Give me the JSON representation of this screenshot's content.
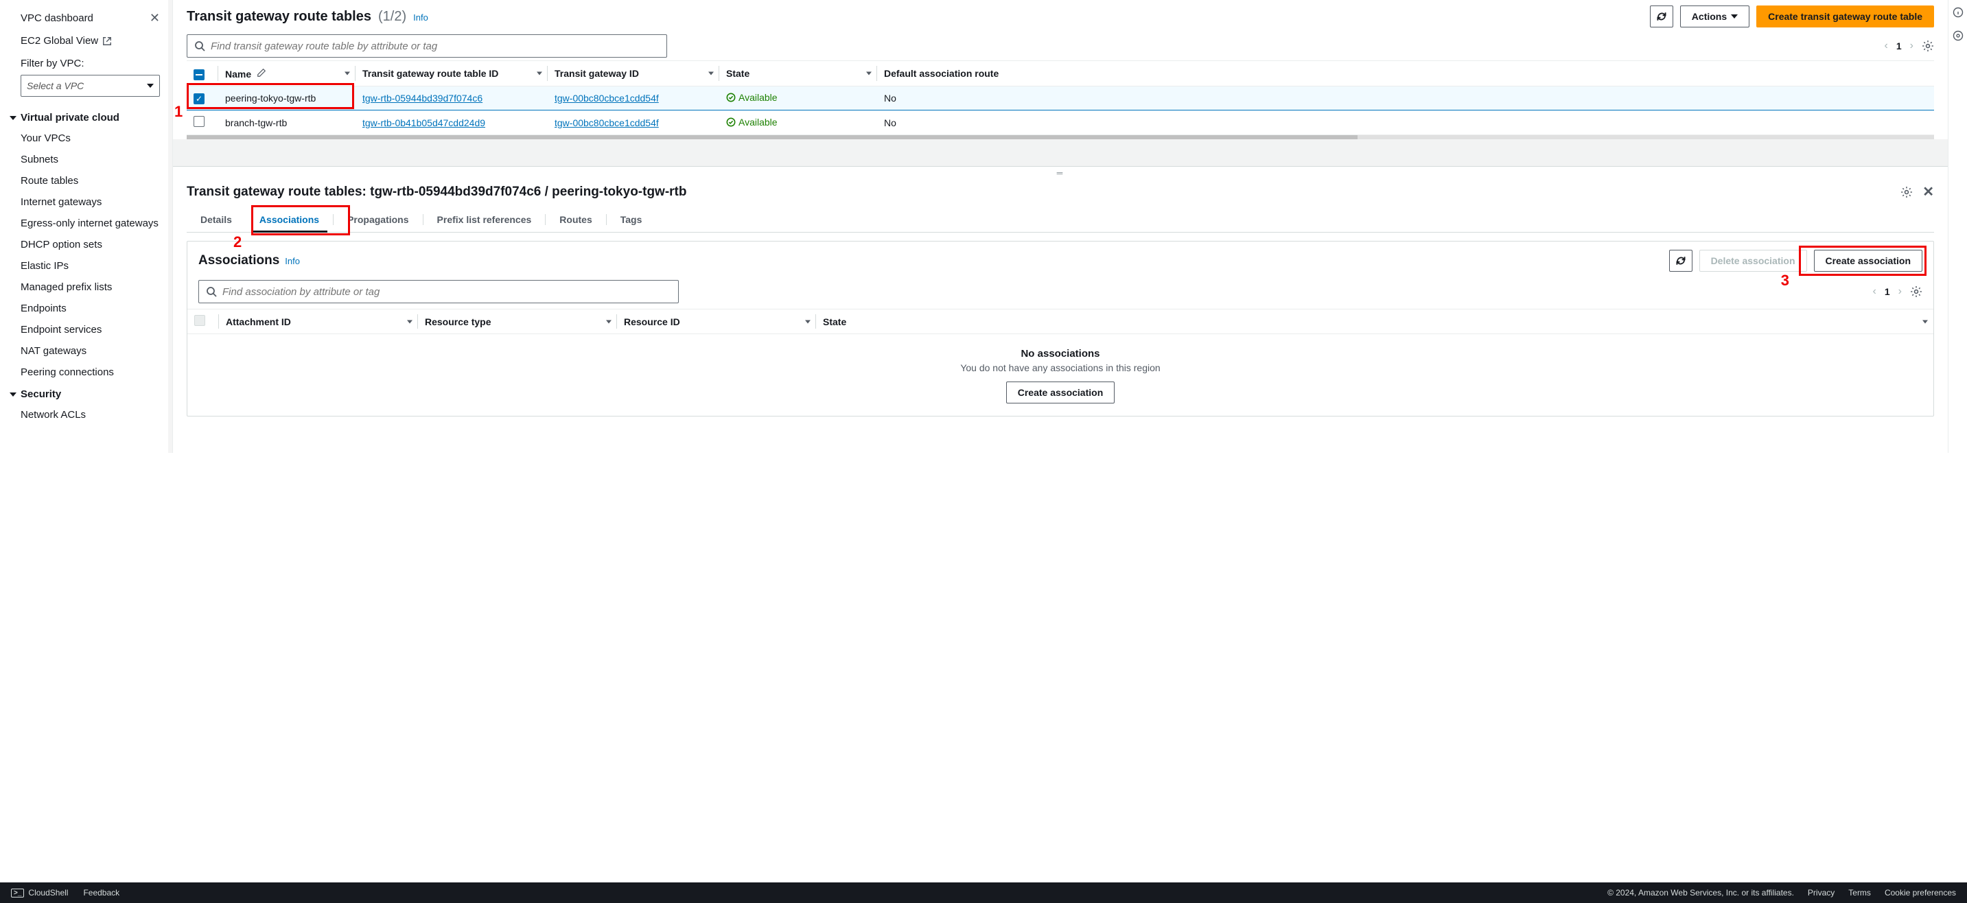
{
  "sidebar": {
    "dashboard": "VPC dashboard",
    "ec2_global": "EC2 Global View",
    "filter_label": "Filter by VPC:",
    "filter_placeholder": "Select a VPC",
    "groups": [
      {
        "title": "Virtual private cloud",
        "items": [
          "Your VPCs",
          "Subnets",
          "Route tables",
          "Internet gateways",
          "Egress-only internet gateways",
          "DHCP option sets",
          "Elastic IPs",
          "Managed prefix lists",
          "Endpoints",
          "Endpoint services",
          "NAT gateways",
          "Peering connections"
        ]
      },
      {
        "title": "Security",
        "items": [
          "Network ACLs"
        ]
      }
    ]
  },
  "header": {
    "title": "Transit gateway route tables",
    "count": "(1/2)",
    "info": "Info",
    "refresh_aria": "Refresh",
    "actions": "Actions",
    "create": "Create transit gateway route table"
  },
  "search": {
    "placeholder": "Find transit gateway route table by attribute or tag"
  },
  "pager": {
    "page": "1"
  },
  "table": {
    "columns": [
      "Name",
      "Transit gateway route table ID",
      "Transit gateway ID",
      "State",
      "Default association route"
    ],
    "rows": [
      {
        "selected": true,
        "name": "peering-tokyo-tgw-rtb",
        "rtb_id": "tgw-rtb-05944bd39d7f074c6",
        "tgw_id": "tgw-00bc80cbce1cdd54f",
        "state": "Available",
        "default_assoc": "No"
      },
      {
        "selected": false,
        "name": "branch-tgw-rtb",
        "rtb_id": "tgw-rtb-0b41b05d47cdd24d9",
        "tgw_id": "tgw-00bc80cbce1cdd54f",
        "state": "Available",
        "default_assoc": "No"
      }
    ]
  },
  "detail": {
    "title": "Transit gateway route tables: tgw-rtb-05944bd39d7f074c6 / peering-tokyo-tgw-rtb",
    "tabs": [
      "Details",
      "Associations",
      "Propagations",
      "Prefix list references",
      "Routes",
      "Tags"
    ],
    "active_tab": 1,
    "assoc": {
      "title": "Associations",
      "info": "Info",
      "delete": "Delete association",
      "create": "Create association",
      "search_placeholder": "Find association by attribute or tag",
      "page": "1",
      "columns": [
        "Attachment ID",
        "Resource type",
        "Resource ID",
        "State"
      ],
      "empty_title": "No associations",
      "empty_sub": "You do not have any associations in this region",
      "empty_action": "Create association"
    }
  },
  "footer": {
    "cloudshell": "CloudShell",
    "feedback": "Feedback",
    "copyright": "© 2024, Amazon Web Services, Inc. or its affiliates.",
    "privacy": "Privacy",
    "terms": "Terms",
    "cookie": "Cookie preferences"
  },
  "annotations": {
    "a1": "1",
    "a2": "2",
    "a3": "3"
  }
}
